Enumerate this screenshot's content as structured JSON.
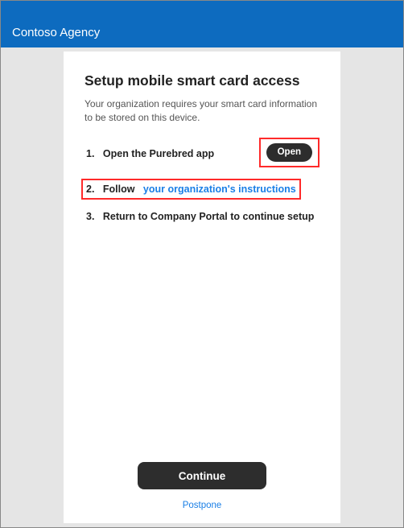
{
  "header": {
    "title": "Contoso Agency"
  },
  "main": {
    "title": "Setup mobile smart card access",
    "subtitle": "Your organization requires your smart card information to be stored on this device.",
    "steps": {
      "s1": {
        "num": "1.",
        "text": "Open the Purebred app",
        "open_label": "Open"
      },
      "s2": {
        "num": "2.",
        "prefix": "Follow",
        "link": "your organization's instructions"
      },
      "s3": {
        "num": "3.",
        "text": "Return to Company Portal to continue setup"
      }
    },
    "continue_label": "Continue",
    "postpone_label": "Postpone"
  },
  "colors": {
    "accent": "#0d6bbf",
    "link": "#1a7fe6",
    "highlight": "#ff2a2a"
  }
}
